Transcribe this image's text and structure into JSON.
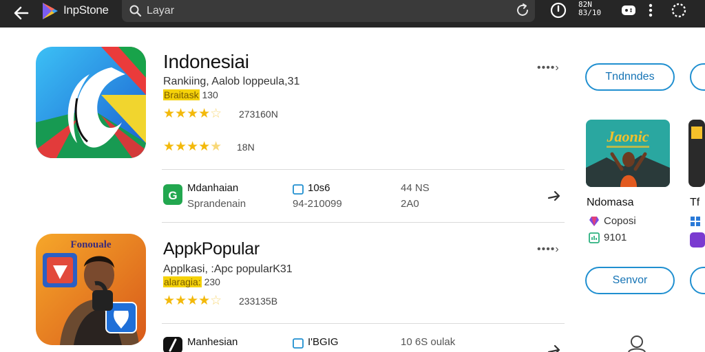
{
  "topbar": {
    "brand": "InpStone",
    "search_placeholder": "Layar",
    "status_line1": "82N",
    "status_line2": "83/10"
  },
  "apps": [
    {
      "name": "Indonesiai",
      "subtitle": "Rankiing, Aalob loppeula,31",
      "tag_highlight": "Braitask",
      "tag_rest": " 130",
      "rating_top": "273160N",
      "rating_second": "18N",
      "meta": {
        "developer": "Mdanhaian",
        "developer_sub": "Sprandenain",
        "size": "10s6",
        "size_sub": "94-210099",
        "downloads": "44 NS",
        "downloads_sub": "2A0"
      },
      "stars_top": 4.5,
      "stars_second": 4.5
    },
    {
      "name": "AppkPopular",
      "subtitle": "Applkasi, :Apc popularK31",
      "tag_highlight": "alaragia:",
      "tag_rest": " 230",
      "rating_top": "233135B",
      "icon_text": "Fonouale",
      "meta": {
        "developer": "Manhesian",
        "size": "I'BGIG",
        "downloads": "10 6S oulak"
      },
      "stars_top": 4.5
    }
  ],
  "sidebar": {
    "pill_top": "Tndnndes",
    "pill_bottom": "Senvor",
    "card": {
      "image_text": "Jaonic",
      "title": "Ndomasa",
      "line1": "Coposi",
      "line2": "9101"
    },
    "card2_title": "Tf"
  },
  "colors": {
    "topbar": "#262626",
    "accent_blue": "#1f8fd0",
    "star": "#f3b90b",
    "highlight": "#f5d20a"
  }
}
